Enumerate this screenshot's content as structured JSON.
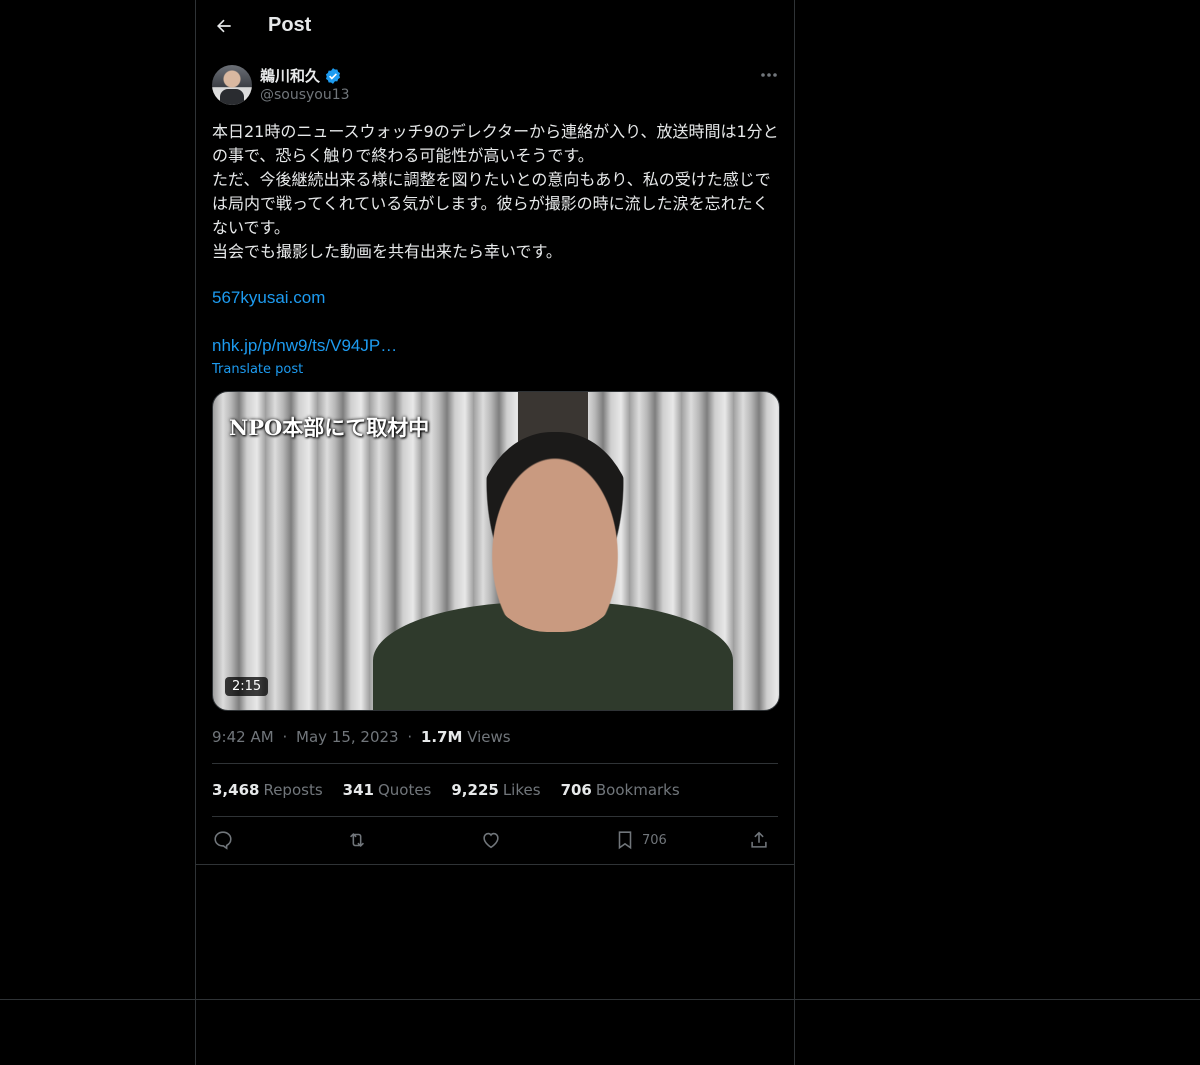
{
  "header": {
    "title": "Post"
  },
  "author": {
    "name": "鵜川和久",
    "handle": "@sousyou13"
  },
  "tweet": {
    "text": "本日21時のニュースウォッチ9のデレクターから連絡が入り、放送時間は1分との事で、恐らく触りで終わる可能性が高いそうです。\nただ、今後継続出来る様に調整を図りたいとの意向もあり、私の受けた感じでは局内で戦ってくれている気がします。彼らが撮影の時に流した涙を忘れたくないです。\n当会でも撮影した動画を共有出来たら幸いです。",
    "link1": "567kyusai.com",
    "link2": "nhk.jp/p/nw9/ts/V94JP…",
    "translate": "Translate post"
  },
  "media": {
    "caption": "NPO本部にて取材中",
    "duration": "2:15"
  },
  "meta": {
    "time": "9:42 AM",
    "dot1": "·",
    "date": "May 15, 2023",
    "dot2": "·",
    "views_count": "1.7M",
    "views_label": "Views"
  },
  "stats": {
    "reposts_count": "3,468",
    "reposts_label": "Reposts",
    "quotes_count": "341",
    "quotes_label": "Quotes",
    "likes_count": "9,225",
    "likes_label": "Likes",
    "bookmarks_count": "706",
    "bookmarks_label": "Bookmarks"
  },
  "actions": {
    "bookmark_count": "706"
  },
  "icons": {
    "back": "arrow-left-icon",
    "verified": "verified-badge-icon",
    "more": "more-icon",
    "reply": "reply-icon",
    "repost": "repost-icon",
    "like": "heart-icon",
    "bookmark": "bookmark-icon",
    "share": "share-icon"
  },
  "colors": {
    "background": "#000000",
    "text": "#e7e9ea",
    "muted": "#71767b",
    "link": "#1d9bf0",
    "verified": "#1d9bf0",
    "border": "#2f3336"
  }
}
